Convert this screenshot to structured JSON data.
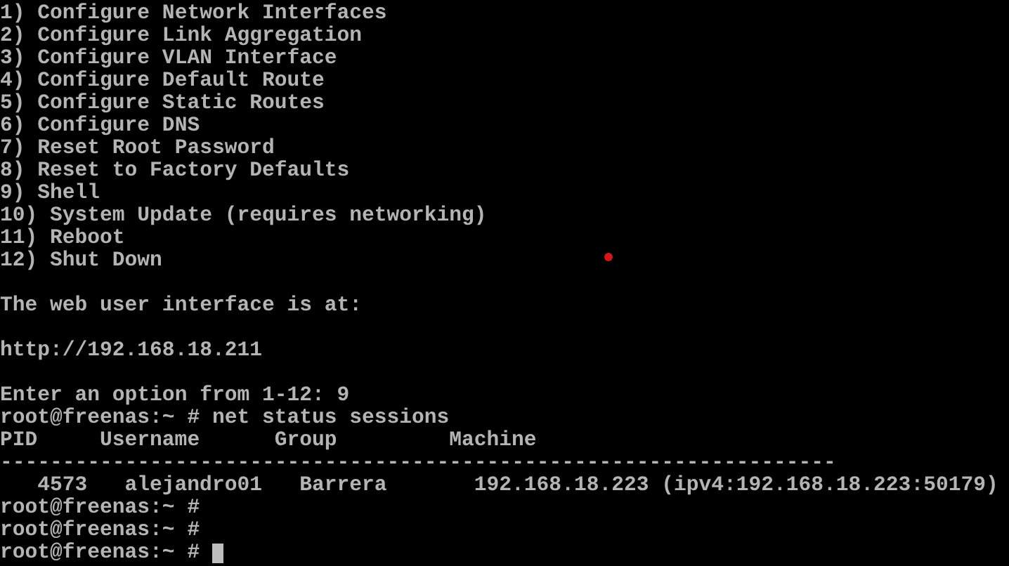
{
  "console": {
    "lines": [
      {
        "kind": "text",
        "text": "1) Configure Network Interfaces"
      },
      {
        "kind": "text",
        "text": "2) Configure Link Aggregation"
      },
      {
        "kind": "text",
        "text": "3) Configure VLAN Interface"
      },
      {
        "kind": "text",
        "text": "4) Configure Default Route"
      },
      {
        "kind": "text",
        "text": "5) Configure Static Routes"
      },
      {
        "kind": "text",
        "text": "6) Configure DNS"
      },
      {
        "kind": "text",
        "text": "7) Reset Root Password"
      },
      {
        "kind": "text",
        "text": "8) Reset to Factory Defaults"
      },
      {
        "kind": "text",
        "text": "9) Shell"
      },
      {
        "kind": "text",
        "text": "10) System Update (requires networking)"
      },
      {
        "kind": "text",
        "text": "11) Reboot"
      },
      {
        "kind": "text",
        "text": "12) Shut Down"
      },
      {
        "kind": "blank"
      },
      {
        "kind": "text",
        "text": "The web user interface is at:"
      },
      {
        "kind": "blank"
      },
      {
        "kind": "text",
        "text": "http://192.168.18.211"
      },
      {
        "kind": "blank"
      },
      {
        "kind": "text",
        "text": "Enter an option from 1-12: 9"
      },
      {
        "kind": "text",
        "text": "root@freenas:~ # net status sessions"
      },
      {
        "kind": "header",
        "cells": [
          "PID",
          "Username",
          "Group",
          "Machine"
        ]
      },
      {
        "kind": "rule",
        "text": "-------------------------------------------------------------------"
      },
      {
        "kind": "row",
        "cells": [
          "4573",
          "alejandro01",
          "Barrera",
          "192.168.18.223 (ipv4:192.168.18.223:50179)"
        ]
      },
      {
        "kind": "text",
        "text": "root@freenas:~ #"
      },
      {
        "kind": "text",
        "text": "root@freenas:~ #"
      },
      {
        "kind": "prompt",
        "text": "root@freenas:~ #"
      }
    ]
  }
}
